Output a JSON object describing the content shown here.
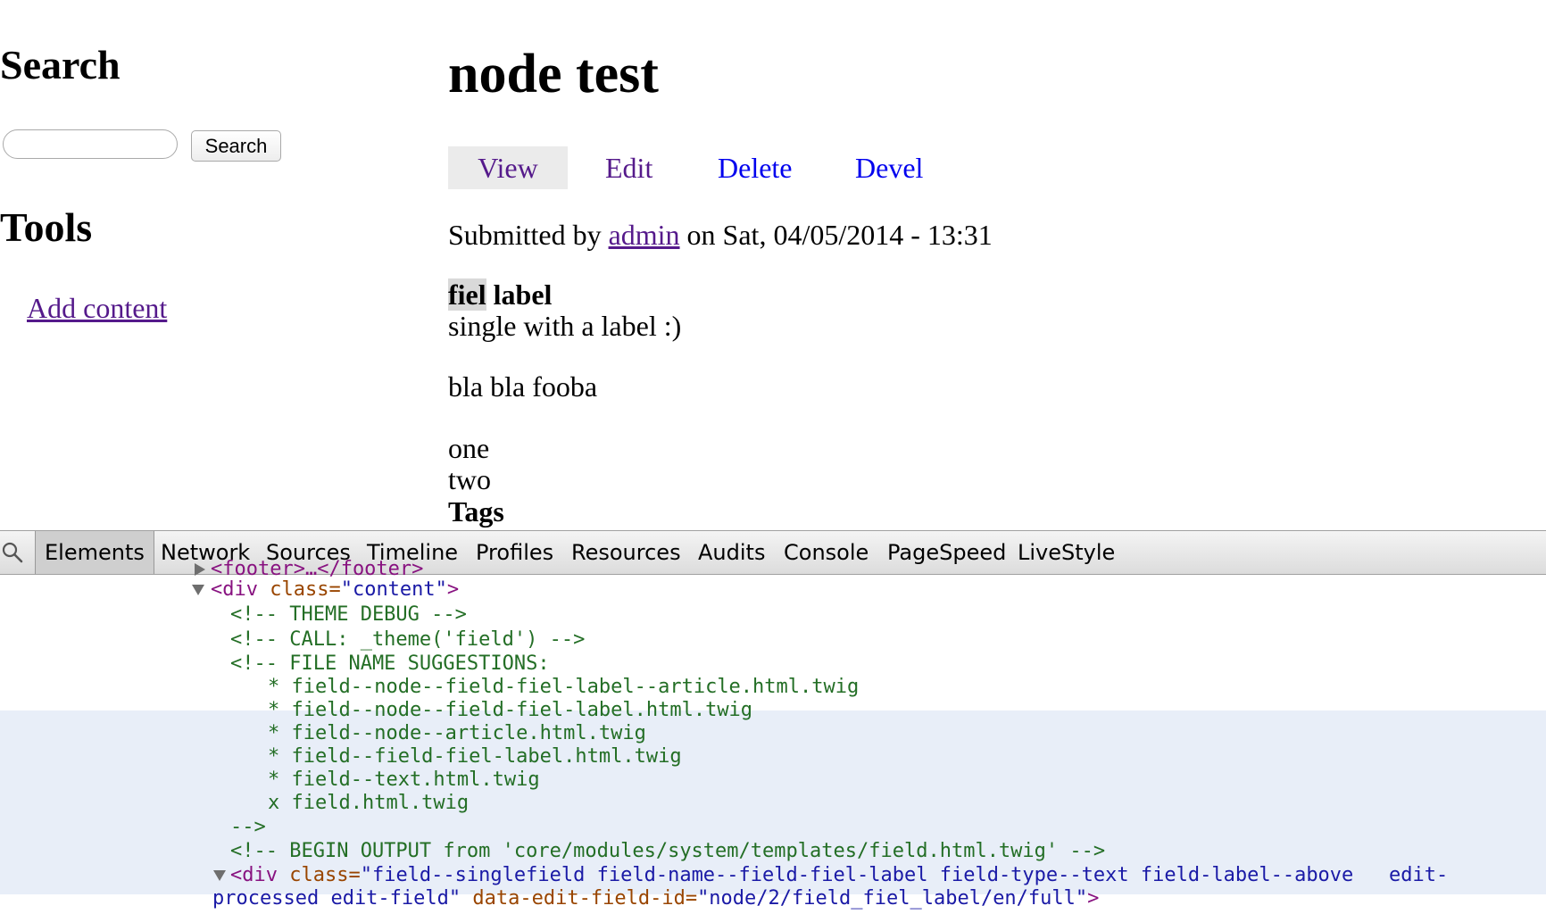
{
  "sidebar": {
    "search_heading": "Search",
    "search_input_value": "",
    "search_button": "Search",
    "tools_heading": "Tools",
    "add_content_link": "Add content"
  },
  "node": {
    "title": "node test",
    "tabs": [
      {
        "label": "View",
        "active": true
      },
      {
        "label": "Edit",
        "active": false
      },
      {
        "label": "Delete",
        "active": false
      },
      {
        "label": "Devel",
        "active": false
      }
    ],
    "submitted_prefix": "Submitted by",
    "author": "admin",
    "submitted_suffix": "on Sat, 04/05/2014 - 13:31",
    "field_label_highlight": "fiel",
    "field_label_rest": " label",
    "field_value": "single with a label :)",
    "body": "bla bla fooba",
    "items": [
      "one",
      "two"
    ],
    "tags_label": "Tags"
  },
  "devtools": {
    "tabs": [
      "Elements",
      "Network",
      "Sources",
      "Timeline",
      "Profiles",
      "Resources",
      "Audits",
      "Console",
      "PageSpeed",
      "LiveStyle"
    ],
    "active_tab": "Elements",
    "partial_top_line": "<footer>…</footer>",
    "content_div": {
      "tag_open": "<div",
      "attr": " class=",
      "value": "\"content\"",
      "tag_close": ">"
    },
    "comment_theme_debug": "<!-- THEME DEBUG -->",
    "comment_call": "<!-- CALL: _theme('field') -->",
    "comment_suggestions_open": "<!-- FILE NAME SUGGESTIONS:",
    "suggestions": [
      "* field--node--field-fiel-label--article.html.twig",
      "* field--node--field-fiel-label.html.twig",
      "* field--node--article.html.twig",
      "* field--field-fiel-label.html.twig",
      "* field--text.html.twig",
      "x field.html.twig"
    ],
    "comment_close": "-->",
    "comment_begin_output": "<!-- BEGIN OUTPUT from 'core/modules/system/templates/field.html.twig' -->",
    "field_div": {
      "tag_open": "<div",
      "attr_class": " class=",
      "class_value": "\"field--singlefield field-name--field-fiel-label field-type--text field-label--above   edit-",
      "class_value_cont": "processed edit-field\"",
      "attr_data": " data-edit-field-id=",
      "data_value": "\"node/2/field_fiel_label/en/full\"",
      "tag_close": ">"
    },
    "colors": {
      "tag": "#881280",
      "attribute": "#994500",
      "value": "#1a1aa6",
      "comment": "#236e25",
      "highlight": "#e8eef8"
    }
  }
}
